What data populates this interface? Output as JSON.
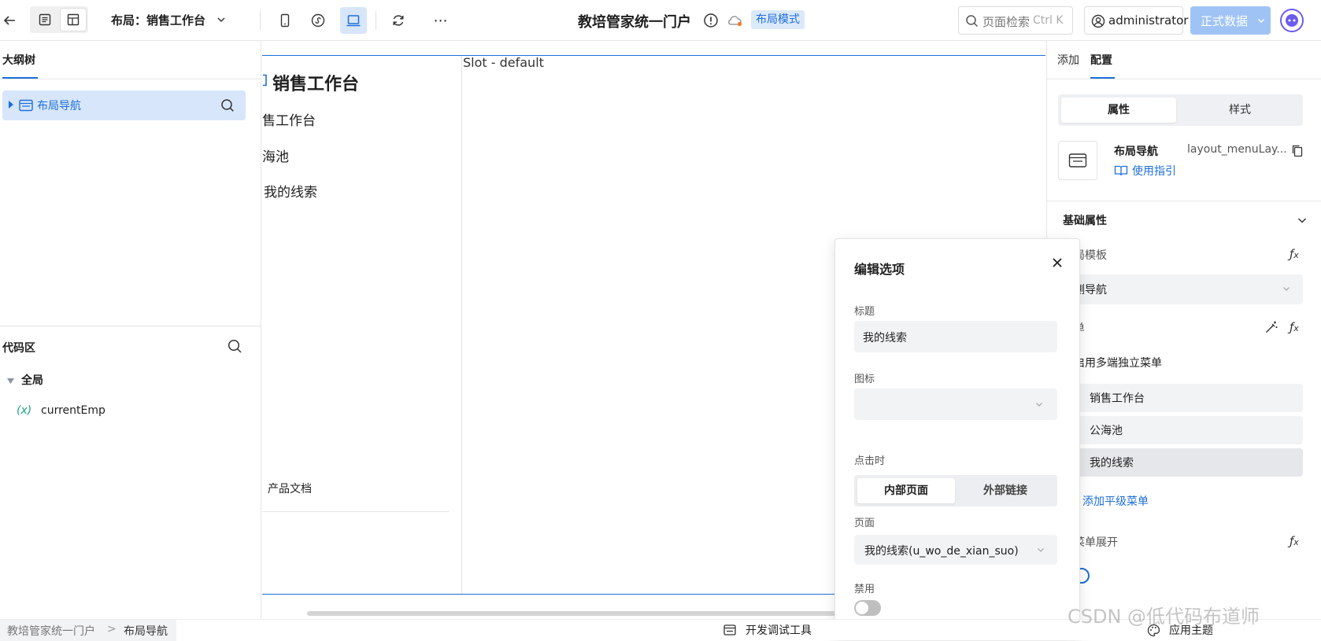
{
  "topbar": {
    "layout_label": "布局：销售工作台",
    "app_title": "教培管家统一门户",
    "mode_badge": "布局模式",
    "search_placeholder": "页面检索",
    "search_shortcut": "Ctrl K",
    "user_name": "administrator",
    "env_button": "正式数据"
  },
  "left": {
    "outline_tab": "大纲树",
    "tree_item": "布局导航",
    "code_title": "代码区",
    "global_label": "全局",
    "var_prefix": "(x)",
    "var_name": "currentEmp"
  },
  "canvas": {
    "slot_label": "Slot - default",
    "brand_title": "销售工作台",
    "menu_items": [
      "售工作台",
      "海池",
      "我的线索"
    ],
    "footer_item": "产品文档"
  },
  "right": {
    "tab_add": "添加",
    "tab_config": "配置",
    "seg_props": "属性",
    "seg_style": "样式",
    "comp_name": "布局导航",
    "comp_id": "layout_menuLay...",
    "guide_link": "使用指引",
    "section_basic": "基础属性",
    "layout_template_label": "局模板",
    "layout_template_value": "侧导航",
    "menu_label": "单",
    "multi_menu_label": "启用多端独立菜单",
    "menu_items": [
      "销售工作台",
      "公海池",
      "我的线索"
    ],
    "add_menu": "添加平级菜单",
    "expand_label": "菜单展开"
  },
  "popover": {
    "title": "编辑选项",
    "label_title": "标题",
    "title_value": "我的线索",
    "label_icon": "图标",
    "label_click": "点击时",
    "seg_internal": "内部页面",
    "seg_external": "外部链接",
    "label_page": "页面",
    "page_value": "我的线索(u_wo_de_xian_suo)",
    "label_disabled": "禁用"
  },
  "statusbar": {
    "breadcrumb_root": "教培管家统一门户",
    "breadcrumb_sep": ">",
    "breadcrumb_current": "布局导航",
    "debug_tool": "开发调试工具",
    "theme": "应用主题",
    "watermark": "CSDN @低代码布道师"
  },
  "colors": {
    "accent": "#1e6fd9",
    "selected_bg": "#d7e6fb",
    "badge_bg": "#dbe9fb",
    "env_btn": "#9fc3f5"
  }
}
